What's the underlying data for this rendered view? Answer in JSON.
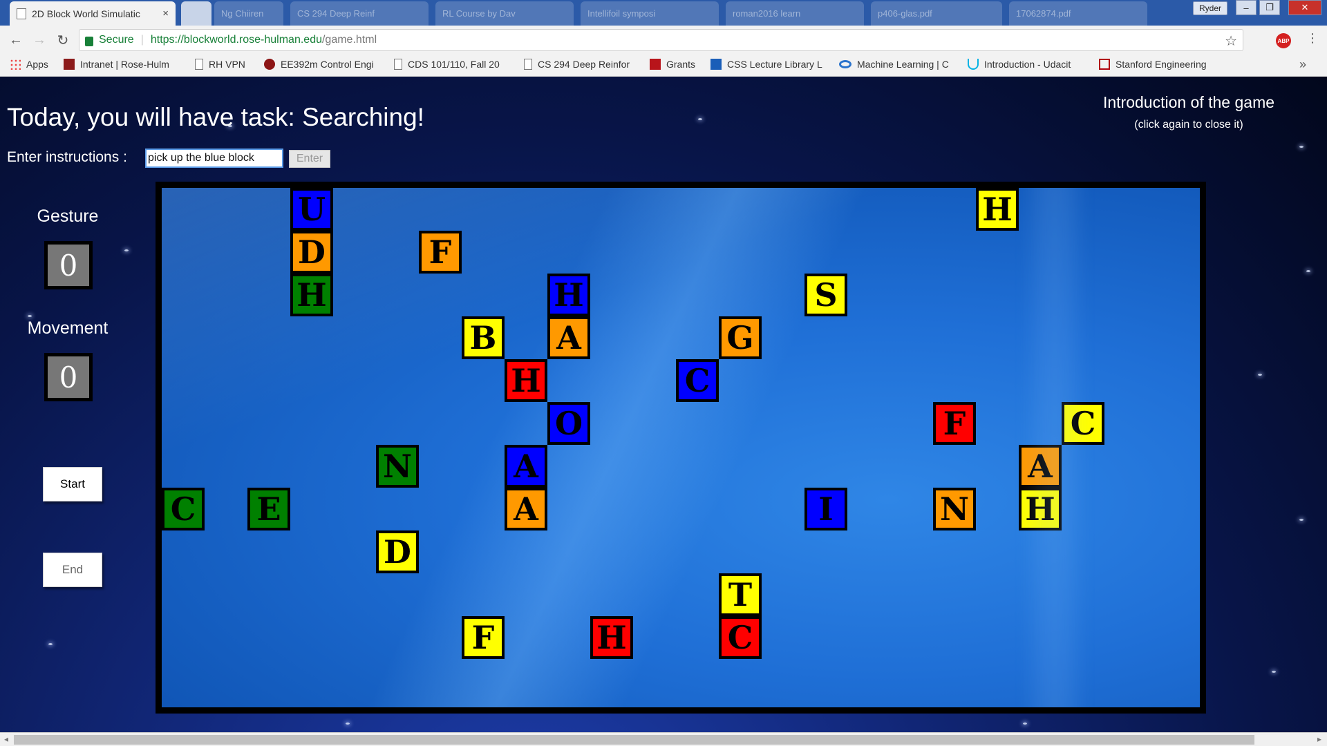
{
  "browser": {
    "active_tab": "2D Block World Simulatic",
    "tab_close": "×",
    "bg_tabs": [
      "Ng Chiiren",
      "CS 294 Deep Reinf",
      "RL Course by Dav",
      "Intellifoil symposi",
      "roman2016 learn",
      "p406-glas.pdf",
      "17062874.pdf"
    ],
    "user": "Ryder",
    "window_buttons": [
      "–",
      "❐",
      "✕"
    ],
    "nav": {
      "back": "←",
      "forward": "→",
      "reload": "↻"
    },
    "secure_label": "Secure",
    "url_host": "https://blockworld.rose-hulman.edu",
    "url_path": "/game.html",
    "star": "☆",
    "abp": "ABP",
    "menu": "⋮",
    "bookmarks": [
      "Apps",
      "Intranet | Rose-Hulm",
      "RH VPN",
      "EE392m Control Engi",
      "CDS 101/110, Fall 20",
      "CS 294 Deep Reinfor",
      "Grants",
      "CSS Lecture Library L",
      "Machine Learning | C",
      "Introduction - Udacit",
      "Stanford Engineering"
    ],
    "more": "»"
  },
  "game": {
    "title": "Today, you will have task: Searching!",
    "instructions_label": "Enter instructions :",
    "instructions_value": "pick up the blue block",
    "enter_label": "Enter",
    "intro_title": "Introduction of the game",
    "intro_sub": "(click again to close it)",
    "gesture_label": "Gesture",
    "gesture_value": "0",
    "movement_label": "Movement",
    "movement_value": "0",
    "start_label": "Start",
    "end_label": "End"
  },
  "colors": {
    "yellow": "#ffff00",
    "orange": "#ff9900",
    "blue": "#0000ff",
    "red": "#ff0000",
    "green": "#008000"
  },
  "blocks": [
    {
      "letter": "U",
      "color": "blue",
      "col": 3,
      "row": 0
    },
    {
      "letter": "D",
      "color": "orange",
      "col": 3,
      "row": 1
    },
    {
      "letter": "H",
      "color": "green",
      "col": 3,
      "row": 2
    },
    {
      "letter": "F",
      "color": "orange",
      "col": 6,
      "row": 1
    },
    {
      "letter": "H",
      "color": "blue",
      "col": 9,
      "row": 2
    },
    {
      "letter": "B",
      "color": "yellow",
      "col": 7,
      "row": 3
    },
    {
      "letter": "A",
      "color": "orange",
      "col": 9,
      "row": 3
    },
    {
      "letter": "H",
      "color": "red",
      "col": 8,
      "row": 4
    },
    {
      "letter": "O",
      "color": "blue",
      "col": 9,
      "row": 5
    },
    {
      "letter": "N",
      "color": "green",
      "col": 5,
      "row": 6
    },
    {
      "letter": "A",
      "color": "blue",
      "col": 8,
      "row": 6
    },
    {
      "letter": "A",
      "color": "orange",
      "col": 8,
      "row": 7
    },
    {
      "letter": "C",
      "color": "green",
      "col": 0,
      "row": 7
    },
    {
      "letter": "E",
      "color": "green",
      "col": 2,
      "row": 7
    },
    {
      "letter": "D",
      "color": "yellow",
      "col": 5,
      "row": 8
    },
    {
      "letter": "F",
      "color": "yellow",
      "col": 7,
      "row": 10
    },
    {
      "letter": "H",
      "color": "red",
      "col": 10,
      "row": 10
    },
    {
      "letter": "T",
      "color": "yellow",
      "col": 13,
      "row": 9
    },
    {
      "letter": "C",
      "color": "red",
      "col": 13,
      "row": 10
    },
    {
      "letter": "G",
      "color": "orange",
      "col": 13,
      "row": 3
    },
    {
      "letter": "C",
      "color": "blue",
      "col": 12,
      "row": 4
    },
    {
      "letter": "S",
      "color": "yellow",
      "col": 15,
      "row": 2
    },
    {
      "letter": "I",
      "color": "blue",
      "col": 15,
      "row": 7
    },
    {
      "letter": "H",
      "color": "yellow",
      "col": 19,
      "row": 0
    },
    {
      "letter": "F",
      "color": "red",
      "col": 18,
      "row": 5
    },
    {
      "letter": "N",
      "color": "orange",
      "col": 18,
      "row": 7
    },
    {
      "letter": "C",
      "color": "yellow",
      "col": 21,
      "row": 5
    },
    {
      "letter": "A",
      "color": "orange",
      "col": 20,
      "row": 6
    },
    {
      "letter": "H",
      "color": "yellow",
      "col": 20,
      "row": 7
    }
  ]
}
